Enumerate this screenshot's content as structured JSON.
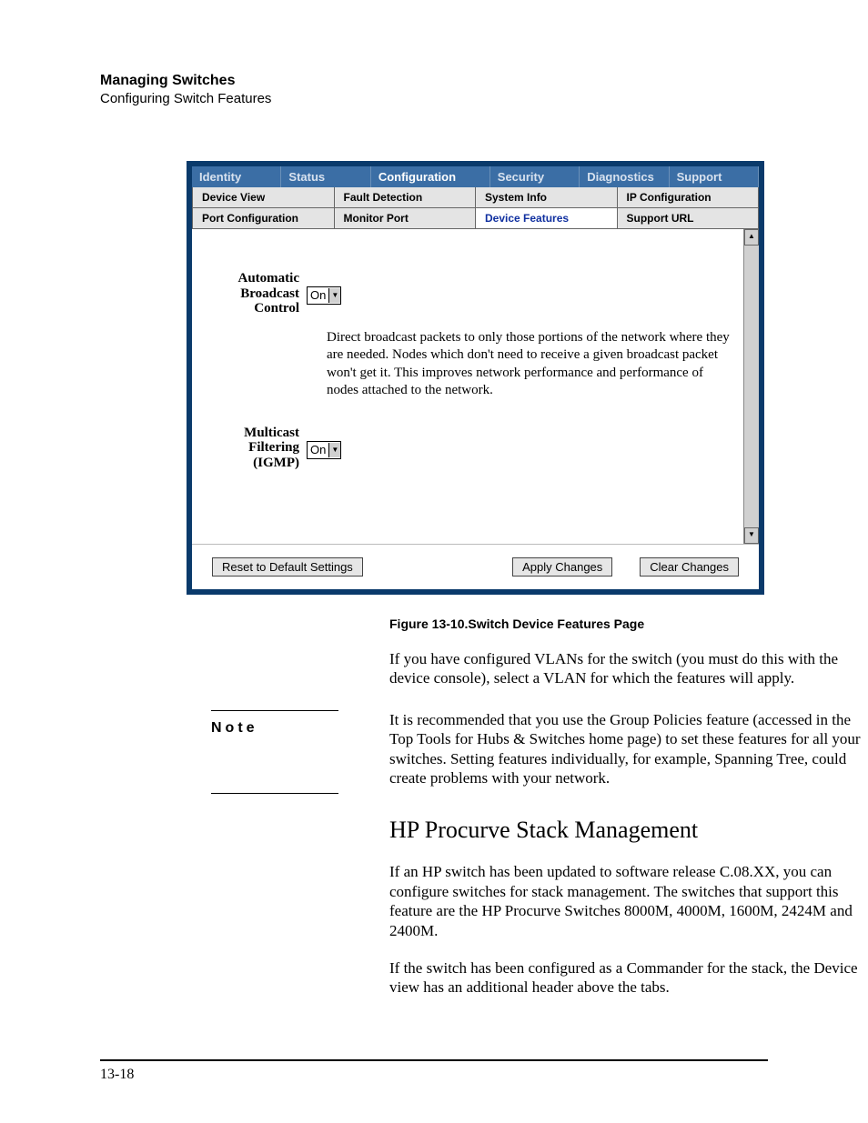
{
  "header": {
    "title": "Managing Switches",
    "subtitle": "Configuring Switch Features"
  },
  "screenshot": {
    "navtabs": [
      "Identity",
      "Status",
      "Configuration",
      "Security",
      "Diagnostics",
      "Support"
    ],
    "subrow1": [
      "Device View",
      "Fault Detection",
      "System Info",
      "IP Configuration"
    ],
    "subrow2": [
      "Port Configuration",
      "Monitor Port",
      "Device Features",
      "Support URL"
    ],
    "field1": {
      "l1": "Automatic",
      "l2": "Broadcast",
      "l3": "Control",
      "value": "On",
      "desc": "Direct broadcast packets to only those portions of the network where they are needed. Nodes which don't need to receive a given broadcast packet won't get it. This improves network performance and performance of nodes attached to the network."
    },
    "field2": {
      "l1": "Multicast",
      "l2": "Filtering",
      "l3": "(IGMP)",
      "value": "On"
    },
    "buttons": {
      "reset": "Reset to Default Settings",
      "apply": "Apply Changes",
      "clear": "Clear Changes"
    }
  },
  "caption": "Figure 13-10.Switch Device Features Page",
  "para1": "If you have configured VLANs for the switch (you must do this with the device console), select a VLAN for which the features will apply.",
  "note": {
    "label": "Note",
    "text": "It is recommended that you use the Group Policies feature (accessed in the Top Tools for Hubs & Switches home page) to set these features for all your switches. Setting features individually, for example, Spanning Tree, could create problems with your network."
  },
  "h2": "HP Procurve Stack Management",
  "para2": "If an HP switch has been updated to software release C.08.XX, you can configure switches for stack management. The switches that support this feature are the HP Procurve Switches 8000M, 4000M, 1600M, 2424M and 2400M.",
  "para3": "If the switch has been configured as a Commander for the stack, the Device view has an additional header above the tabs.",
  "pageno": "13-18"
}
